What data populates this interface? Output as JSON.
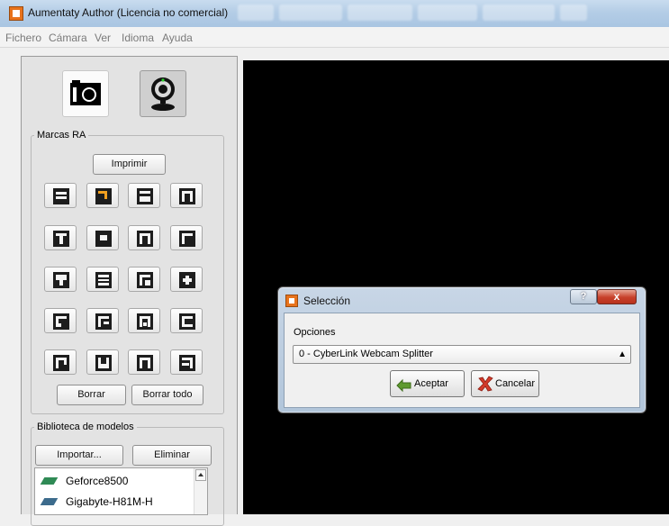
{
  "window": {
    "title": "Aumentaty Author (Licencia no comercial)"
  },
  "menu": [
    "Fichero",
    "Cámara",
    "Ver",
    "Idioma",
    "Ayuda"
  ],
  "source_buttons": {
    "camera_icon": "photo-camera-icon",
    "webcam_icon": "webcam-icon"
  },
  "markers_group": {
    "label": "Marcas RA",
    "print_label": "Imprimir",
    "delete_label": "Borrar",
    "delete_all_label": "Borrar todo",
    "selected_marker": 1
  },
  "models_group": {
    "label": "Biblioteca de modelos",
    "import_label": "Importar...",
    "remove_label": "Eliminar",
    "items": [
      "Geforce8500",
      "Gigabyte-H81M-H"
    ]
  },
  "dialog": {
    "title": "Selección",
    "help_label": "?",
    "close_label": "x",
    "options_label": "Opciones",
    "selected_option": "0 - CyberLink Webcam Splitter",
    "accept_label": "Aceptar",
    "cancel_label": "Cancelar"
  },
  "colors": {
    "accent": "#e8731c",
    "marker_selected": "#f2a020",
    "viewport": "#000000"
  }
}
